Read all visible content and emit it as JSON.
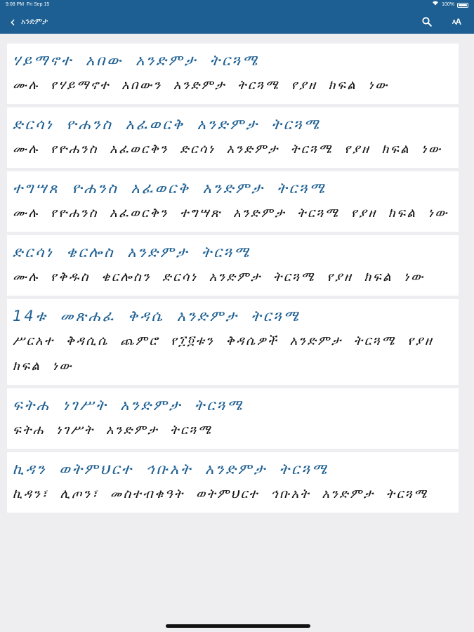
{
  "status_bar": {
    "time": "9:08 PM",
    "date": "Fri Sep 15",
    "battery": "100%"
  },
  "nav": {
    "back_label": "አንድምታ",
    "search_icon": "search-icon",
    "font_size_icon": "text-size-icon",
    "font_size_glyph": "AA"
  },
  "items": [
    {
      "title": "ሃይማኖተ አበው አንድምታ ትርጓሜ",
      "description": "ሙሉ የሃይማኖተ አበውን አንድምታ ትርጓሜ የያዘ ክፍል ነው"
    },
    {
      "title": "ድርሳነ ዮሐንስ አፈወርቅ አንድምታ ትርጓሜ",
      "description": "ሙሉ የዮሐንስ አፈወርቅን ድርሳነ አንድምታ ትርጓሜ የያዘ ክፍል ነው"
    },
    {
      "title": "ተግሣጸ ዮሐንስ አፈወርቅ አንድምታ ትርጓሜ",
      "description": "ሙሉ የዮሐንስ አፈወርቅን ተግሣጽ አንድምታ ትርጓሜ የያዘ ክፍል ነው"
    },
    {
      "title": "ድርሳነ ቄርሎስ አንድምታ ትርጓሜ",
      "description": "ሙሉ የቅዱስ ቄርሎስን ድርሳነ አንድምታ ትርጓሜ የያዘ ክፍል ነው"
    },
    {
      "title": "14ቱ መጽሐፈ ቅዳሴ አንድምታ ትርጓሜ",
      "description": "ሥርአተ ቅዳሲሴ ጨምሮ የ፲፬ቱን ቅዳሴዎች አንድምታ ትርጓሜ የያዘ ክፍል ነው"
    },
    {
      "title": "ፍትሐ ነገሥት አንድምታ ትርጓሜ",
      "description": "ፍትሐ ነገሥት አንድምታ ትርጓሜ"
    },
    {
      "title": "ኪዳን ወትምህርተ ኅቡአት አንድምታ ትርጓሜ",
      "description": "ኪዳን፣ ሊጦን፣ መስተብቁዓት ወትምህርተ ኅቡአት አንድምታ ትርጓሜ"
    }
  ]
}
